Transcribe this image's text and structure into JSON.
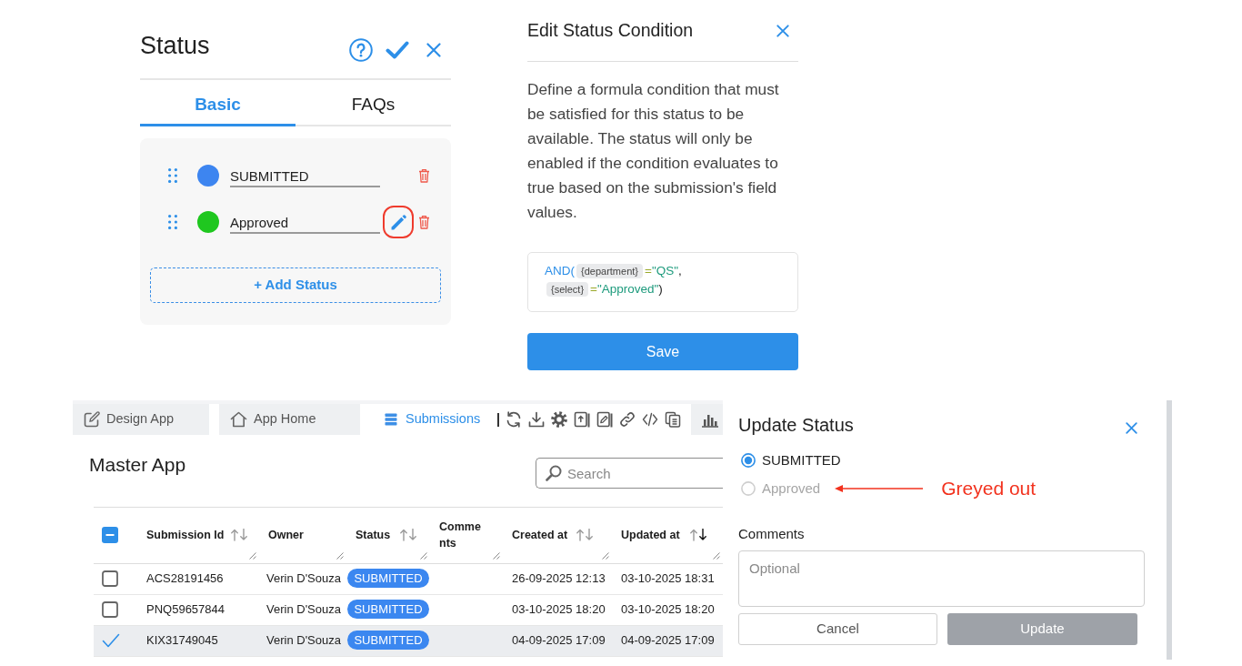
{
  "status_panel": {
    "title": "Status",
    "tabs": [
      {
        "label": "Basic",
        "selected": true
      },
      {
        "label": "FAQs",
        "selected": false
      }
    ],
    "statuses": [
      {
        "name": "SUBMITTED",
        "color": "#3d85f0",
        "highlighted": false
      },
      {
        "name": "Approved",
        "color": "#1fc71f",
        "highlighted": true
      }
    ],
    "add_button": "+ Add Status"
  },
  "condition_panel": {
    "title": "Edit Status Condition",
    "description": "Define a formula condition that must be satisfied for this status to be available. The status will only be enabled if the condition evaluates to true based on the submission's field values.",
    "formula_lines": [
      [
        {
          "kind": "function",
          "text": "AND("
        },
        {
          "kind": "field",
          "text": "{department}"
        },
        {
          "kind": "operator",
          "text": "="
        },
        {
          "kind": "string",
          "text": "\"QS\""
        },
        {
          "kind": "punct",
          "text": ","
        }
      ],
      [
        {
          "kind": "field",
          "text": "{select}"
        },
        {
          "kind": "operator",
          "text": "="
        },
        {
          "kind": "string",
          "text": "\"Approved\""
        },
        {
          "kind": "punct",
          "text": ")"
        }
      ]
    ],
    "save_button": "Save"
  },
  "app": {
    "tabs": [
      {
        "label": "Design App",
        "selected": false
      },
      {
        "label": "App Home",
        "selected": false
      },
      {
        "label": "Submissions",
        "selected": true
      }
    ],
    "title": "Master App",
    "search": {
      "placeholder": "Search"
    },
    "table": {
      "select_all": {
        "indeterminate": true
      },
      "columns": [
        {
          "label": "Submission Id",
          "sortable": true,
          "sorted_descending": false
        },
        {
          "label": "Owner",
          "sortable": false,
          "sorted_descending": false
        },
        {
          "label": "Status",
          "sortable": true,
          "sorted_descending": false
        },
        {
          "label": "Comments",
          "sortable": false,
          "sorted_descending": false
        },
        {
          "label": "Created at",
          "sortable": true,
          "sorted_descending": false
        },
        {
          "label": "Updated at",
          "sortable": true,
          "sorted_descending": true
        }
      ],
      "rows": [
        {
          "selected": false,
          "submission_id": "ACS28191456",
          "owner": "Verin D'Souza",
          "status": "SUBMITTED",
          "created_at": "26-09-2025 12:13",
          "updated_at": "03-10-2025 18:31"
        },
        {
          "selected": false,
          "submission_id": "PNQ59657844",
          "owner": "Verin D'Souza",
          "status": "SUBMITTED",
          "created_at": "03-10-2025 18:20",
          "updated_at": "03-10-2025 18:20"
        },
        {
          "selected": true,
          "submission_id": "KIX31749045",
          "owner": "Verin D'Souza",
          "status": "SUBMITTED",
          "created_at": "04-09-2025 17:09",
          "updated_at": "04-09-2025 17:09"
        }
      ]
    }
  },
  "update_panel": {
    "title": "Update Status",
    "options": [
      {
        "label": "SUBMITTED",
        "selected": true,
        "disabled": false
      },
      {
        "label": "Approved",
        "selected": false,
        "disabled": true,
        "annotation": "Greyed out"
      }
    ],
    "comments": {
      "label": "Comments",
      "placeholder": "Optional"
    },
    "buttons": [
      {
        "label": "Cancel",
        "kind": "secondary",
        "disabled": false
      },
      {
        "label": "Update",
        "kind": "primary",
        "disabled": true
      }
    ]
  }
}
